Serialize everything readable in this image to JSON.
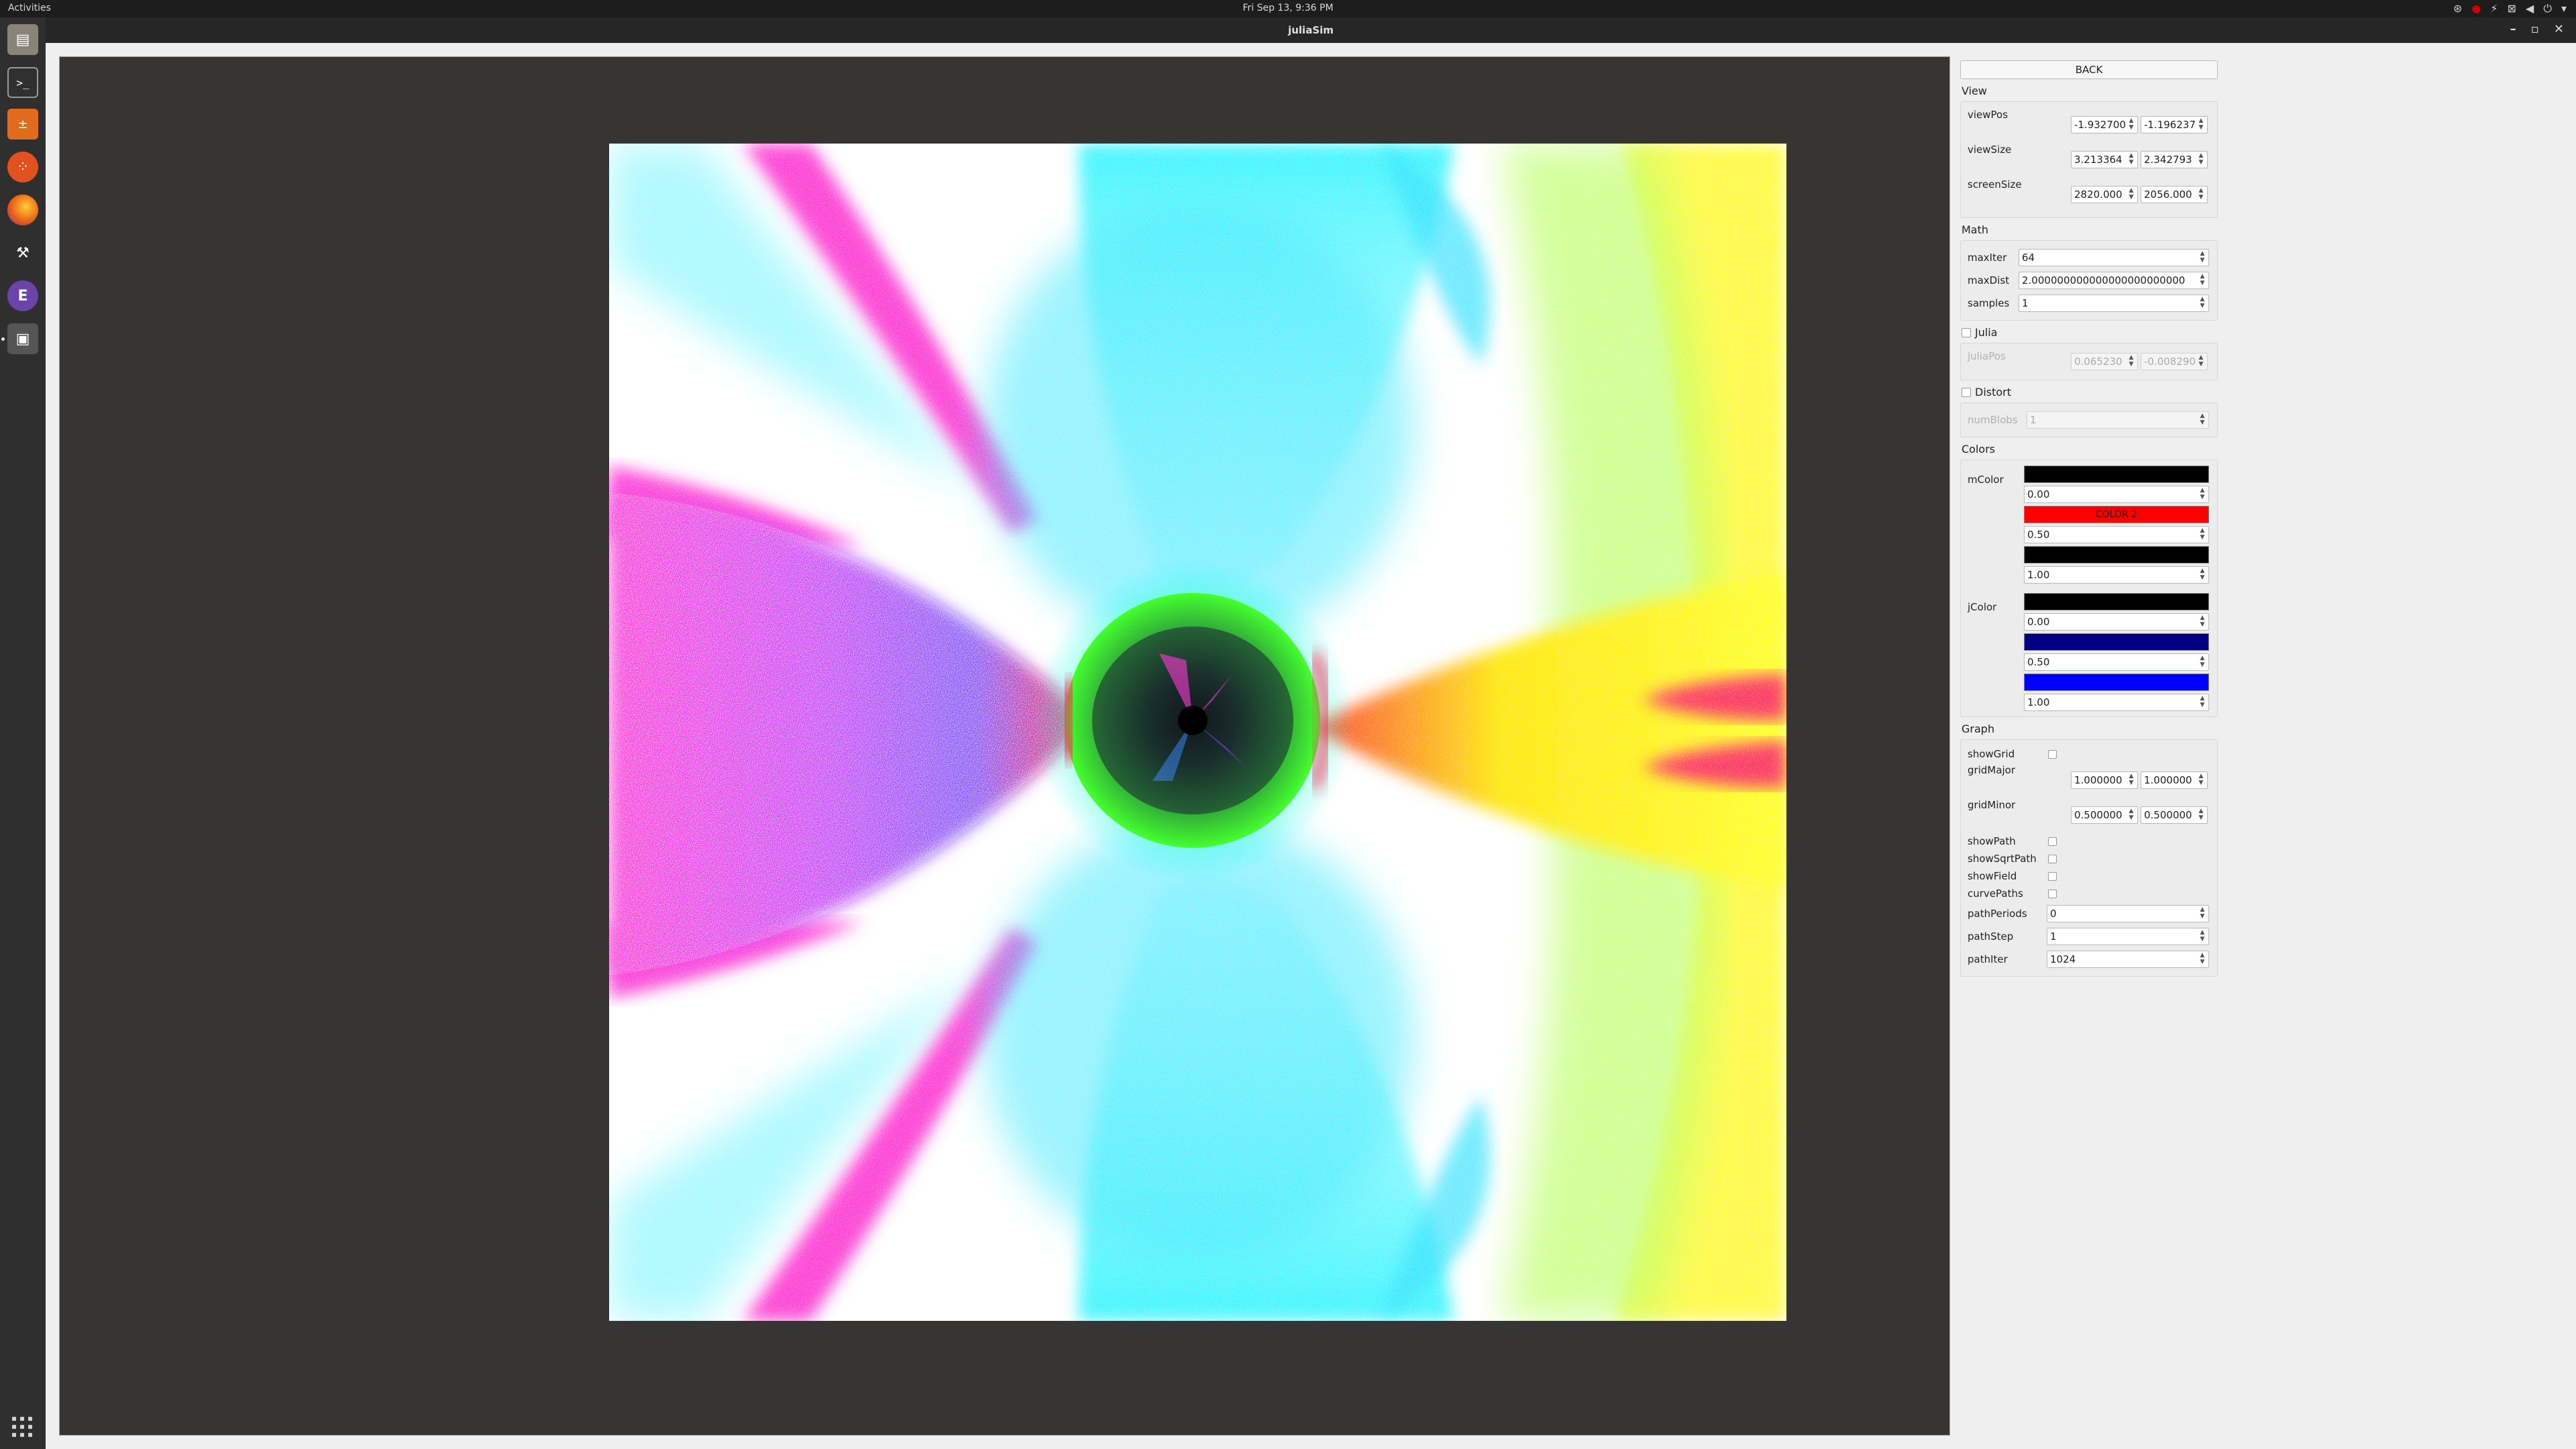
{
  "topbar": {
    "activities": "Activities",
    "clock": "Fri Sep 13,  9:36 PM"
  },
  "window": {
    "title": "juliaSim"
  },
  "panel": {
    "back_label": "BACK",
    "view": {
      "label": "View",
      "viewPos": {
        "label": "viewPos",
        "x": "-1.932700",
        "y": "-1.196237"
      },
      "viewSize": {
        "label": "viewSize",
        "x": "3.213364",
        "y": "2.342793"
      },
      "screenSize": {
        "label": "screenSize",
        "x": "2820.000",
        "y": "2056.000"
      }
    },
    "math": {
      "label": "Math",
      "maxIter": {
        "label": "maxIter",
        "value": "64"
      },
      "maxDist": {
        "label": "maxDist",
        "value": "2.000000000000000000000000"
      },
      "samples": {
        "label": "samples",
        "value": "1"
      }
    },
    "julia": {
      "label": "Julia",
      "checked": false,
      "juliaPos": {
        "label": "juliaPos",
        "x": "0.065230",
        "y": "-0.008290"
      }
    },
    "distort": {
      "label": "Distort",
      "checked": false,
      "numBlobs": {
        "label": "numBlobs",
        "value": "1"
      }
    },
    "colors": {
      "label": "Colors",
      "mColor": {
        "label": "mColor",
        "stops": [
          {
            "color": "#000000",
            "name": "",
            "pos": "0.00"
          },
          {
            "color": "#ff0000",
            "name": "COLOR 2",
            "pos": "0.50"
          },
          {
            "color": "#000000",
            "name": "",
            "pos": "1.00"
          }
        ]
      },
      "jColor": {
        "label": "jColor",
        "stops": [
          {
            "color": "#000000",
            "name": "",
            "pos": "0.00"
          },
          {
            "color": "#000080",
            "name": "",
            "pos": "0.50"
          },
          {
            "color": "#0000ff",
            "name": "",
            "pos": "1.00"
          }
        ]
      }
    },
    "graph": {
      "label": "Graph",
      "showGrid": {
        "label": "showGrid",
        "checked": false
      },
      "gridMajor": {
        "label": "gridMajor",
        "x": "1.000000",
        "y": "1.000000"
      },
      "gridMinor": {
        "label": "gridMinor",
        "x": "0.500000",
        "y": "0.500000"
      },
      "showPath": {
        "label": "showPath",
        "checked": false
      },
      "showSqrtPath": {
        "label": "showSqrtPath",
        "checked": false
      },
      "showField": {
        "label": "showField",
        "checked": false
      },
      "curvePaths": {
        "label": "curvePaths",
        "checked": false
      },
      "pathPeriods": {
        "label": "pathPeriods",
        "value": "0"
      },
      "pathStep": {
        "label": "pathStep",
        "value": "1"
      },
      "pathIter": {
        "label": "pathIter",
        "value": "1024"
      }
    }
  }
}
